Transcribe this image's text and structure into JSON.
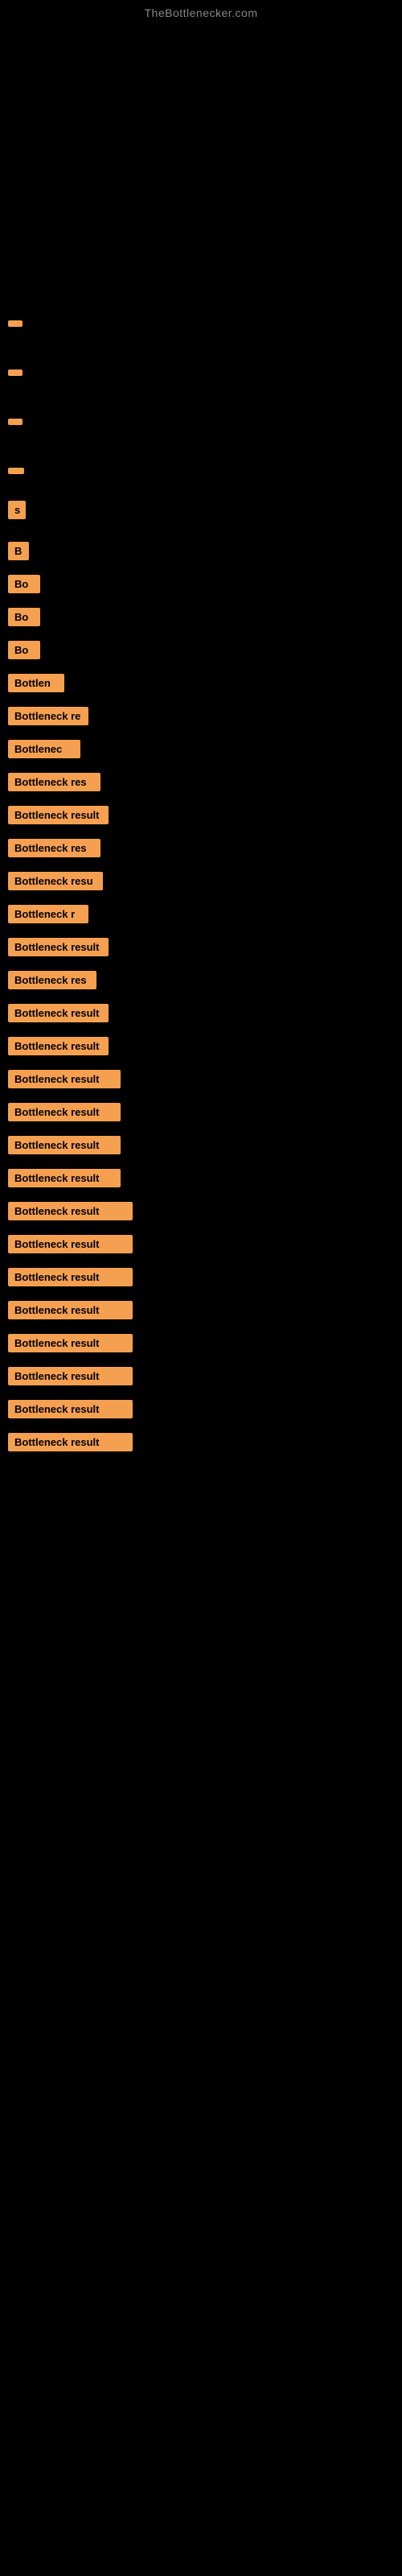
{
  "site": {
    "title": "TheBottlenecker.com"
  },
  "items": [
    {
      "id": 1,
      "label": "",
      "class": "item-1"
    },
    {
      "id": 2,
      "label": "",
      "class": "item-2"
    },
    {
      "id": 3,
      "label": "",
      "class": "item-3"
    },
    {
      "id": 4,
      "label": "",
      "class": "item-4"
    },
    {
      "id": 5,
      "label": "s",
      "class": "item-5"
    },
    {
      "id": 6,
      "label": "B",
      "class": "item-6"
    },
    {
      "id": 7,
      "label": "Bo",
      "class": "item-7"
    },
    {
      "id": 8,
      "label": "Bo",
      "class": "item-8"
    },
    {
      "id": 9,
      "label": "Bo",
      "class": "item-9"
    },
    {
      "id": 10,
      "label": "Bottlen",
      "class": "item-10"
    },
    {
      "id": 11,
      "label": "Bottleneck re",
      "class": "item-11"
    },
    {
      "id": 12,
      "label": "Bottlenec",
      "class": "item-12"
    },
    {
      "id": 13,
      "label": "Bottleneck res",
      "class": "item-13"
    },
    {
      "id": 14,
      "label": "Bottleneck result",
      "class": "item-14"
    },
    {
      "id": 15,
      "label": "Bottleneck res",
      "class": "item-15"
    },
    {
      "id": 16,
      "label": "Bottleneck resu",
      "class": "item-16"
    },
    {
      "id": 17,
      "label": "Bottleneck r",
      "class": "item-17"
    },
    {
      "id": 18,
      "label": "Bottleneck result",
      "class": "item-18"
    },
    {
      "id": 19,
      "label": "Bottleneck res",
      "class": "item-19"
    },
    {
      "id": 20,
      "label": "Bottleneck result",
      "class": "item-20"
    },
    {
      "id": 21,
      "label": "Bottleneck result",
      "class": "item-21"
    },
    {
      "id": 22,
      "label": "Bottleneck result",
      "class": "item-22"
    },
    {
      "id": 23,
      "label": "Bottleneck result",
      "class": "item-23"
    },
    {
      "id": 24,
      "label": "Bottleneck result",
      "class": "item-24"
    },
    {
      "id": 25,
      "label": "Bottleneck result",
      "class": "item-25"
    },
    {
      "id": 26,
      "label": "Bottleneck result",
      "class": "item-26"
    },
    {
      "id": 27,
      "label": "Bottleneck result",
      "class": "item-27"
    },
    {
      "id": 28,
      "label": "Bottleneck result",
      "class": "item-28"
    },
    {
      "id": 29,
      "label": "Bottleneck result",
      "class": "item-29"
    },
    {
      "id": 30,
      "label": "Bottleneck result",
      "class": "item-30"
    },
    {
      "id": 31,
      "label": "Bottleneck result",
      "class": "item-31"
    },
    {
      "id": 32,
      "label": "Bottleneck result",
      "class": "item-32"
    },
    {
      "id": 33,
      "label": "Bottleneck result",
      "class": "item-33"
    }
  ]
}
